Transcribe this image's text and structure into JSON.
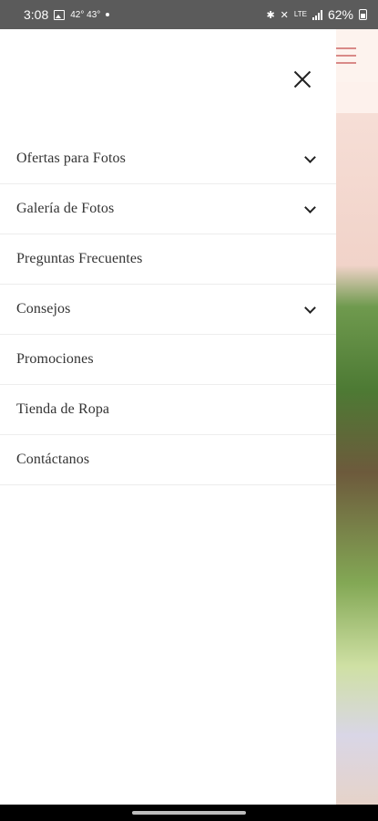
{
  "status_bar": {
    "time": "3:08",
    "temperature": "42° 43°",
    "network": "LTE",
    "battery": "62%"
  },
  "drawer": {
    "menu_items": [
      {
        "label": "Ofertas para Fotos",
        "has_submenu": true
      },
      {
        "label": "Galería de Fotos",
        "has_submenu": true
      },
      {
        "label": "Preguntas Frecuentes",
        "has_submenu": false
      },
      {
        "label": "Consejos",
        "has_submenu": true
      },
      {
        "label": "Promociones",
        "has_submenu": false
      },
      {
        "label": "Tienda de Ropa",
        "has_submenu": false
      },
      {
        "label": "Contáctanos",
        "has_submenu": false
      }
    ]
  },
  "colors": {
    "status_bar_bg": "#5b5b5b",
    "menu_text": "#333333",
    "divider": "#ededed",
    "hamburger_accent": "#d98a88"
  }
}
